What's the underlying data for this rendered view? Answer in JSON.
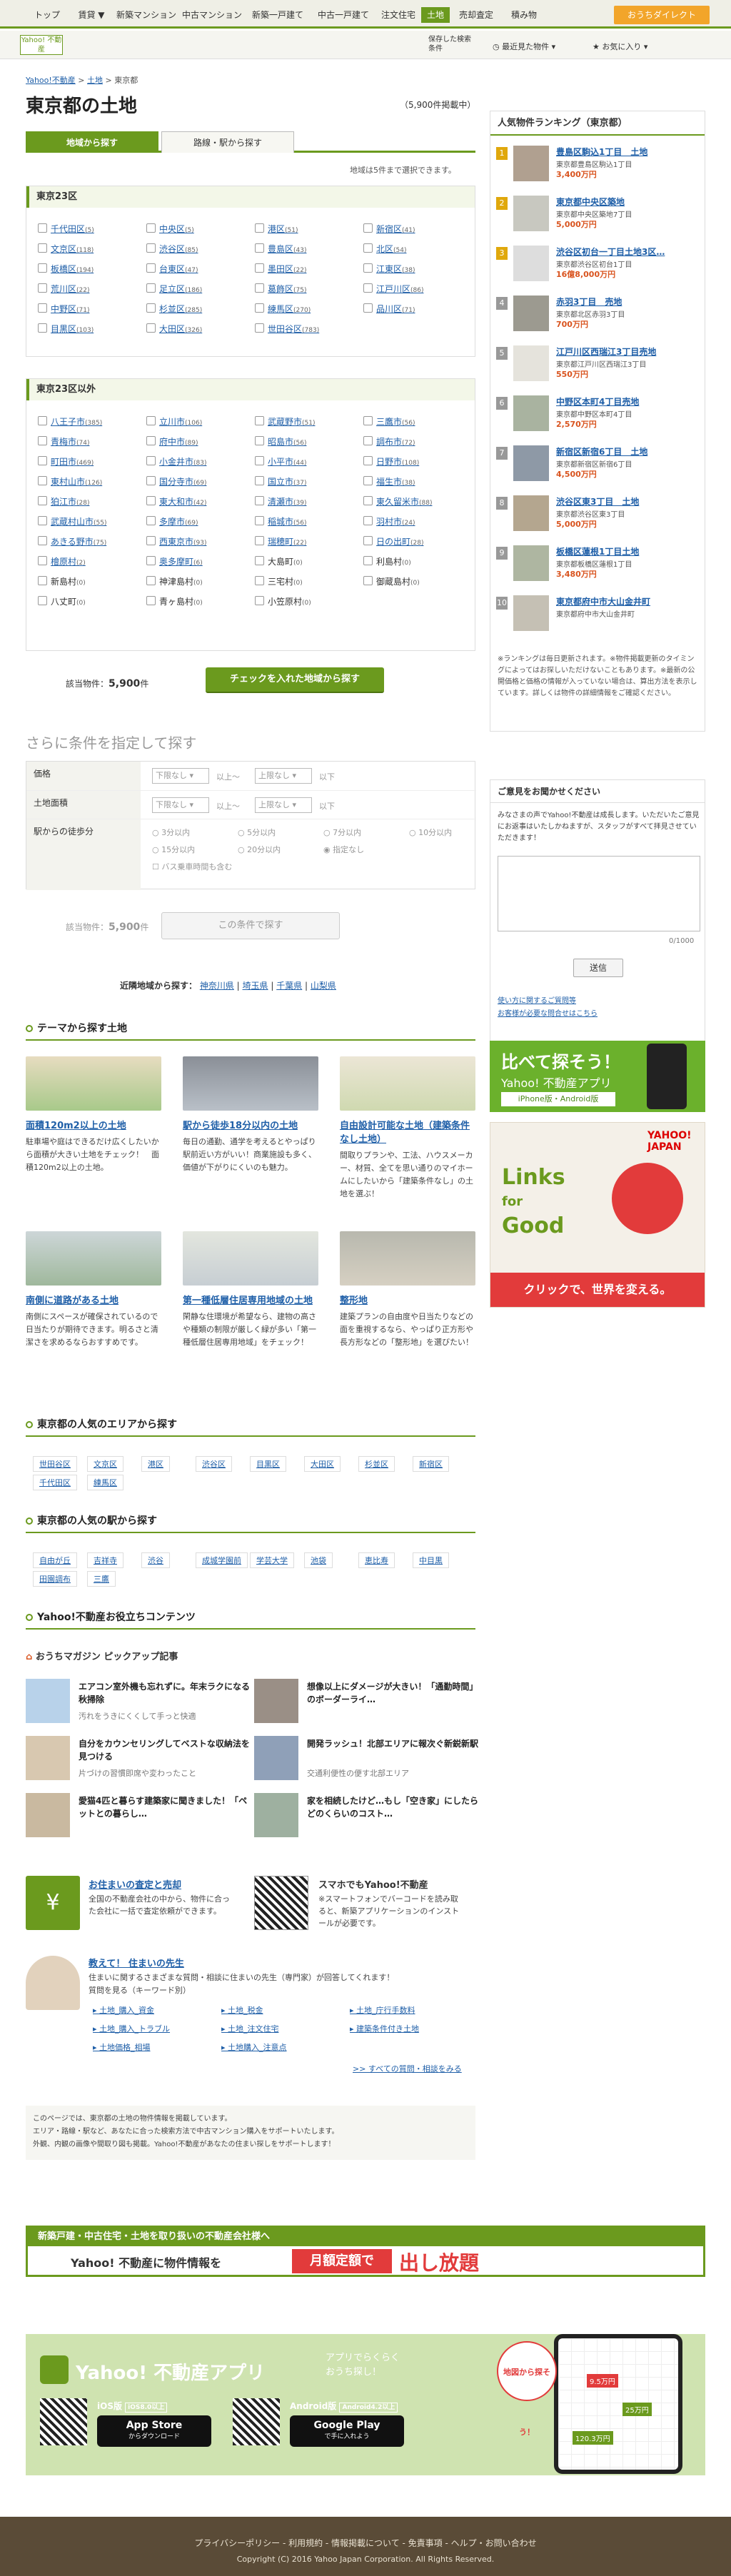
{
  "topnav": {
    "items": [
      "トップ",
      "賃貸 ▼",
      "新築マンション",
      "中古マンション",
      "新築一戸建て",
      "中古一戸建て",
      "注文住宅",
      "土地",
      "売却査定",
      "積み物"
    ],
    "direct_label": "おうちダイレクト"
  },
  "subbar": {
    "logo": "Yahoo! 不動産",
    "saved_search": "保存した検索条件",
    "favorites": "最近見た物件",
    "bookmarks": "お気に入り"
  },
  "breadcrumb": [
    "Yahoo!不動産",
    "土地",
    "東京都"
  ],
  "page_title": "東京都の土地",
  "total_count": "（5,900件掲載中）",
  "tabs": [
    "地域から探す",
    "路線・駅から探す"
  ],
  "select_limit_note": "地域は5件まで選択できます。",
  "tokyo23": {
    "header": "東京23区",
    "items": [
      {
        "name": "千代田区",
        "count": "(5)"
      },
      {
        "name": "中央区",
        "count": "(5)"
      },
      {
        "name": "港区",
        "count": "(51)"
      },
      {
        "name": "新宿区",
        "count": "(41)"
      },
      {
        "name": "文京区",
        "count": "(118)"
      },
      {
        "name": "渋谷区",
        "count": "(85)"
      },
      {
        "name": "豊島区",
        "count": "(43)"
      },
      {
        "name": "北区",
        "count": "(54)"
      },
      {
        "name": "板橋区",
        "count": "(194)"
      },
      {
        "name": "台東区",
        "count": "(47)"
      },
      {
        "name": "墨田区",
        "count": "(22)"
      },
      {
        "name": "江東区",
        "count": "(38)"
      },
      {
        "name": "荒川区",
        "count": "(22)"
      },
      {
        "name": "足立区",
        "count": "(186)"
      },
      {
        "name": "葛飾区",
        "count": "(75)"
      },
      {
        "name": "江戸川区",
        "count": "(86)"
      },
      {
        "name": "中野区",
        "count": "(71)"
      },
      {
        "name": "杉並区",
        "count": "(285)"
      },
      {
        "name": "練馬区",
        "count": "(270)"
      },
      {
        "name": "品川区",
        "count": "(71)"
      },
      {
        "name": "目黒区",
        "count": "(103)"
      },
      {
        "name": "大田区",
        "count": "(326)"
      },
      {
        "name": "世田谷区",
        "count": "(783)"
      }
    ]
  },
  "other": {
    "header": "東京23区以外",
    "items": [
      {
        "name": "八王子市",
        "count": "(385)"
      },
      {
        "name": "立川市",
        "count": "(106)"
      },
      {
        "name": "武蔵野市",
        "count": "(51)"
      },
      {
        "name": "三鷹市",
        "count": "(56)"
      },
      {
        "name": "青梅市",
        "count": "(74)"
      },
      {
        "name": "府中市",
        "count": "(89)"
      },
      {
        "name": "昭島市",
        "count": "(56)"
      },
      {
        "name": "調布市",
        "count": "(72)"
      },
      {
        "name": "町田市",
        "count": "(469)"
      },
      {
        "name": "小金井市",
        "count": "(83)"
      },
      {
        "name": "小平市",
        "count": "(44)"
      },
      {
        "name": "日野市",
        "count": "(108)"
      },
      {
        "name": "東村山市",
        "count": "(126)"
      },
      {
        "name": "国分寺市",
        "count": "(69)"
      },
      {
        "name": "国立市",
        "count": "(37)"
      },
      {
        "name": "福生市",
        "count": "(38)"
      },
      {
        "name": "狛江市",
        "count": "(28)"
      },
      {
        "name": "東大和市",
        "count": "(42)"
      },
      {
        "name": "清瀬市",
        "count": "(39)"
      },
      {
        "name": "東久留米市",
        "count": "(88)"
      },
      {
        "name": "武蔵村山市",
        "count": "(55)"
      },
      {
        "name": "多摩市",
        "count": "(69)"
      },
      {
        "name": "稲城市",
        "count": "(56)"
      },
      {
        "name": "羽村市",
        "count": "(24)"
      },
      {
        "name": "あきる野市",
        "count": "(75)"
      },
      {
        "name": "西東京市",
        "count": "(93)"
      },
      {
        "name": "瑞穂町",
        "count": "(22)"
      },
      {
        "name": "日の出町",
        "count": "(28)"
      },
      {
        "name": "檜原村",
        "count": "(2)"
      },
      {
        "name": "奥多摩町",
        "count": "(6)"
      },
      {
        "name": "大島町",
        "count": "(0)"
      },
      {
        "name": "利島村",
        "count": "(0)"
      },
      {
        "name": "新島村",
        "count": "(0)"
      },
      {
        "name": "神津島村",
        "count": "(0)"
      },
      {
        "name": "三宅村",
        "count": "(0)"
      },
      {
        "name": "御蔵島村",
        "count": "(0)"
      },
      {
        "name": "八丈町",
        "count": "(0)"
      },
      {
        "name": "青ヶ島村",
        "count": "(0)"
      },
      {
        "name": "小笠原村",
        "count": "(0)"
      }
    ]
  },
  "result_line": {
    "label": "該当物件：",
    "count": "5,900",
    "unit": "件"
  },
  "search_button": "チェックを入れた地域から探す",
  "more_title": "さらに条件を指定して探す",
  "filters": {
    "price_label": "価格",
    "area_label": "土地面積",
    "walk_label": "駅からの徒歩分",
    "none": "下限なし",
    "none_upper": "上限なし",
    "from": "以上〜",
    "to": "以下",
    "walk_options": [
      "3分以内",
      "5分以内",
      "7分以内",
      "10分以内",
      "15分以内",
      "20分以内",
      "指定なし"
    ],
    "bus_option": "バス乗車時間も含む"
  },
  "result_line2": {
    "label": "該当物件：",
    "count": "5,900",
    "unit": "件"
  },
  "search_button2": "この条件で探す",
  "nearby": {
    "label": "近隣地域から探す：",
    "items": [
      "神奈川県",
      "埼玉県",
      "千葉県",
      "山梨県"
    ]
  },
  "theme_title": "テーマから探す土地",
  "themes": [
    {
      "title": "面積120m2以上の土地",
      "text": "駐車場や庭はできるだけ広くしたいから面積が大きい土地をチェック！　面積120m2以上の土地。",
      "c1": "#a8c98a",
      "c2": "#e7dcc0"
    },
    {
      "title": "駅から徒歩18分以内の土地",
      "text": "毎日の通勤、通学を考えるとやっぱり駅前近い方がいい！商業施設も多く、価値が下がりにくいのも魅力。",
      "c1": "#b9c0c8",
      "c2": "#8a8f97"
    },
    {
      "title": "自由設計可能な土地（建築条件なし土地）",
      "text": "間取りプランや、工法、ハウスメーカー、材質、全てを思い通りのマイホームにしたいから「建築条件なし」の土地を選ぶ！",
      "c1": "#cfd9b0",
      "c2": "#ece6d6"
    },
    {
      "title": "南側に道路がある土地",
      "text": "南側にスペースが確保されているので日当たりが期待できます。明るさと清潔さを求めるならおすすめです。",
      "c1": "#9fb89c",
      "c2": "#cdd6d8"
    },
    {
      "title": "第一種低層住居専用地域の土地",
      "text": "閑静な住環境が希望なら、建物の高さや種類の制限が厳しく緑が多い「第一種低層住居専用地域」をチェック！",
      "c1": "#c7ced3",
      "c2": "#e3e6de"
    },
    {
      "title": "整形地",
      "text": "建築プランの自由度や日当たりなどの面を重視するなら、やっぱり正方形や長方形などの「整形地」を選びたい！",
      "c1": "#d6d0c2",
      "c2": "#b8b8ae"
    }
  ],
  "area_title": "東京都の人気のエリアから探す",
  "areas": [
    "世田谷区",
    "文京区",
    "港区",
    "渋谷区",
    "目黒区",
    "大田区",
    "杉並区",
    "新宿区",
    "千代田区",
    "練馬区"
  ],
  "station_title": "東京都の人気の駅から探す",
  "stations": [
    "自由が丘",
    "吉祥寺",
    "渋谷",
    "成城学園前",
    "学芸大学",
    "池袋",
    "恵比寿",
    "中目黒",
    "田園調布",
    "三鷹"
  ],
  "content_title": "Yahoo!不動産お役立ちコンテンツ",
  "magazine_title": "おうちマガジン ピックアップ記事",
  "articles": [
    {
      "t1": "エアコン室外機も忘れずに。年末ラクになる秋掃除",
      "t2": "汚れをうきにくくして手っと快適",
      "c": "#b8d2ea"
    },
    {
      "t1": "想像以上にダメージが大きい！「通勤時間」のボーダーライ…",
      "t2": "",
      "c": "#9a8f86"
    },
    {
      "t1": "自分をカウンセリングしてベストな収納法を見つける",
      "t2": "片づけの習慣即席や変わったこと",
      "c": "#d8c8b0"
    },
    {
      "t1": "開発ラッシュ！北部エリアに報次ぐ新鋭新駅",
      "t2": "交通利便性の便す北部エリア",
      "c": "#8fa0b8"
    },
    {
      "t1": "愛猫4匹と暮らす建築家に聞きました！「ペットとの暮らし…",
      "t2": "",
      "c": "#c9b9a0"
    },
    {
      "t1": "家を相続したけど…もし「空き家」にしたらどのくらいのコスト…",
      "t2": "",
      "c": "#9eb0a0"
    }
  ],
  "promo1": {
    "title": "お住まいの査定と売却",
    "text": "全国の不動産会社の中から、物件に合った会社に一括で査定依頼ができます。"
  },
  "promo2": {
    "title": "スマホでもYahoo!不動産",
    "text": "※スマートフォンでバーコードを読み取ると、新築アプリケーションのインストールが必要です。"
  },
  "qa": {
    "title": "教えて！ 住まいの先生",
    "text": "住まいに関するさまざまな質問・相談に住まいの先生（専門家）が回答してくれます！",
    "sub": "質問を見る（キーワード別）",
    "links": [
      "土地_購入_資金",
      "土地_税金",
      "土地_庁行手数料",
      "土地_購入_トラブル",
      "土地_注文住宅",
      "建築条件付き土地",
      "土地価格_相場",
      "土地購入_注意点"
    ],
    "more": ">> すべての質問・相談をみる"
  },
  "notice": [
    "このページでは、東京都の土地の物件情報を掲載しています。",
    "エリア・路線・駅など、あなたに合った検索方法で中古マンション購入をサポートいたします。",
    "外観、内観の画像や間取り図も掲載。Yahoo!不動産があなたの住まい探しをサポートします！"
  ],
  "ranking": {
    "title": "人気物件ランキング（東京都）",
    "items": [
      {
        "title": "豊島区駒込1丁目　土地",
        "addr": "東京都豊島区駒込1丁目",
        "price": "3,400万円",
        "c": "#b0a090"
      },
      {
        "title": "東京都中央区築地",
        "addr": "東京都中央区築地7丁目",
        "price": "5,000万円",
        "c": "#c8c8c0"
      },
      {
        "title": "渋谷区初台一丁目土地3区…",
        "addr": "東京都渋谷区初台1丁目",
        "price": "16億8,000万円",
        "c": "#ddd"
      },
      {
        "title": "赤羽3丁目　売地",
        "addr": "東京都北区赤羽3丁目",
        "price": "700万円",
        "c": "#9c9a90"
      },
      {
        "title": "江戸川区西瑞江3丁目売地",
        "addr": "東京都江戸川区西瑞江3丁目",
        "price": "550万円",
        "c": "#e5e3dc"
      },
      {
        "title": "中野区本町4丁目売地",
        "addr": "東京都中野区本町4丁目",
        "price": "2,570万円",
        "c": "#a9b3a0"
      },
      {
        "title": "新宿区新宿6丁目　土地",
        "addr": "東京都新宿区新宿6丁目",
        "price": "4,500万円",
        "c": "#8e99a6"
      },
      {
        "title": "渋谷区東3丁目　土地",
        "addr": "東京都渋谷区東3丁目",
        "price": "5,000万円",
        "c": "#b4a68f"
      },
      {
        "title": "板橋区蓮根1丁目土地",
        "addr": "東京都板橋区蓮根1丁目",
        "price": "3,480万円",
        "c": "#aeb6a1"
      },
      {
        "title": "東京都府中市大山金井町",
        "addr": "東京都府中市大山金井町",
        "price": "",
        "c": "#c5c0b4"
      }
    ],
    "note": "※ランキングは毎日更新されます。※物件掲載更新のタイミングによってはお探しいただけないこともあります。※最新の公開価格と価格の情報が入っていない場合は、算出方法を表示しています。詳しくは物件の詳細情報をご確認ください。"
  },
  "feedback": {
    "title": "ご意見をお聞かせください",
    "text": "みなさまの声でYahoo!不動産は成長します。いただいたご意見にお返事はいたしかねますが、スタッフがすべて拝見させていただきます！",
    "counter": "0/1000",
    "send": "送信",
    "link1": "使い方に関するご質問等",
    "link2": "お客様が必要な問合せはこちら"
  },
  "app_banner": {
    "line1": "比べて探そう！",
    "line2": "Yahoo! 不動産アプリ",
    "line3": "iPhone版・Android版"
  },
  "links_banner": {
    "l1": "Links",
    "l2": "for",
    "l3": "Good",
    "sub": "クリックで、世界を変える。",
    "yahoo": "YAHOO! JAPAN"
  },
  "bottom_banner": {
    "text1": "新築戸建・中古住宅・土地を取り扱いの不動産会社様へ",
    "text2": "Yahoo! 不動産に物件情報を",
    "text3": "月額定額で",
    "text4": "出し放題"
  },
  "app_big": {
    "name": "Yahoo! 不動産アプリ",
    "tag1": "アプリでらくらく",
    "tag2": "おうち探し！",
    "ios": "iOS版",
    "ios_ver": "iOS8.0以上",
    "store": "App Store",
    "store_sub": "からダウンロード",
    "android": "Android版",
    "android_ver": "Android4.2以上",
    "gplay": "Google Play",
    "gplay_sub": "で手に入れよう",
    "bubble": "地図から探そう！",
    "p1": "9.5万円",
    "p2": "25万円",
    "p3": "120.3万円"
  },
  "footer": {
    "links": "プライバシーポリシー - 利用規約 - 情報掲載について - 免責事項 - ヘルプ・お問い合わせ",
    "copy": "Copyright (C) 2016 Yahoo Japan Corporation. All Rights Reserved."
  }
}
